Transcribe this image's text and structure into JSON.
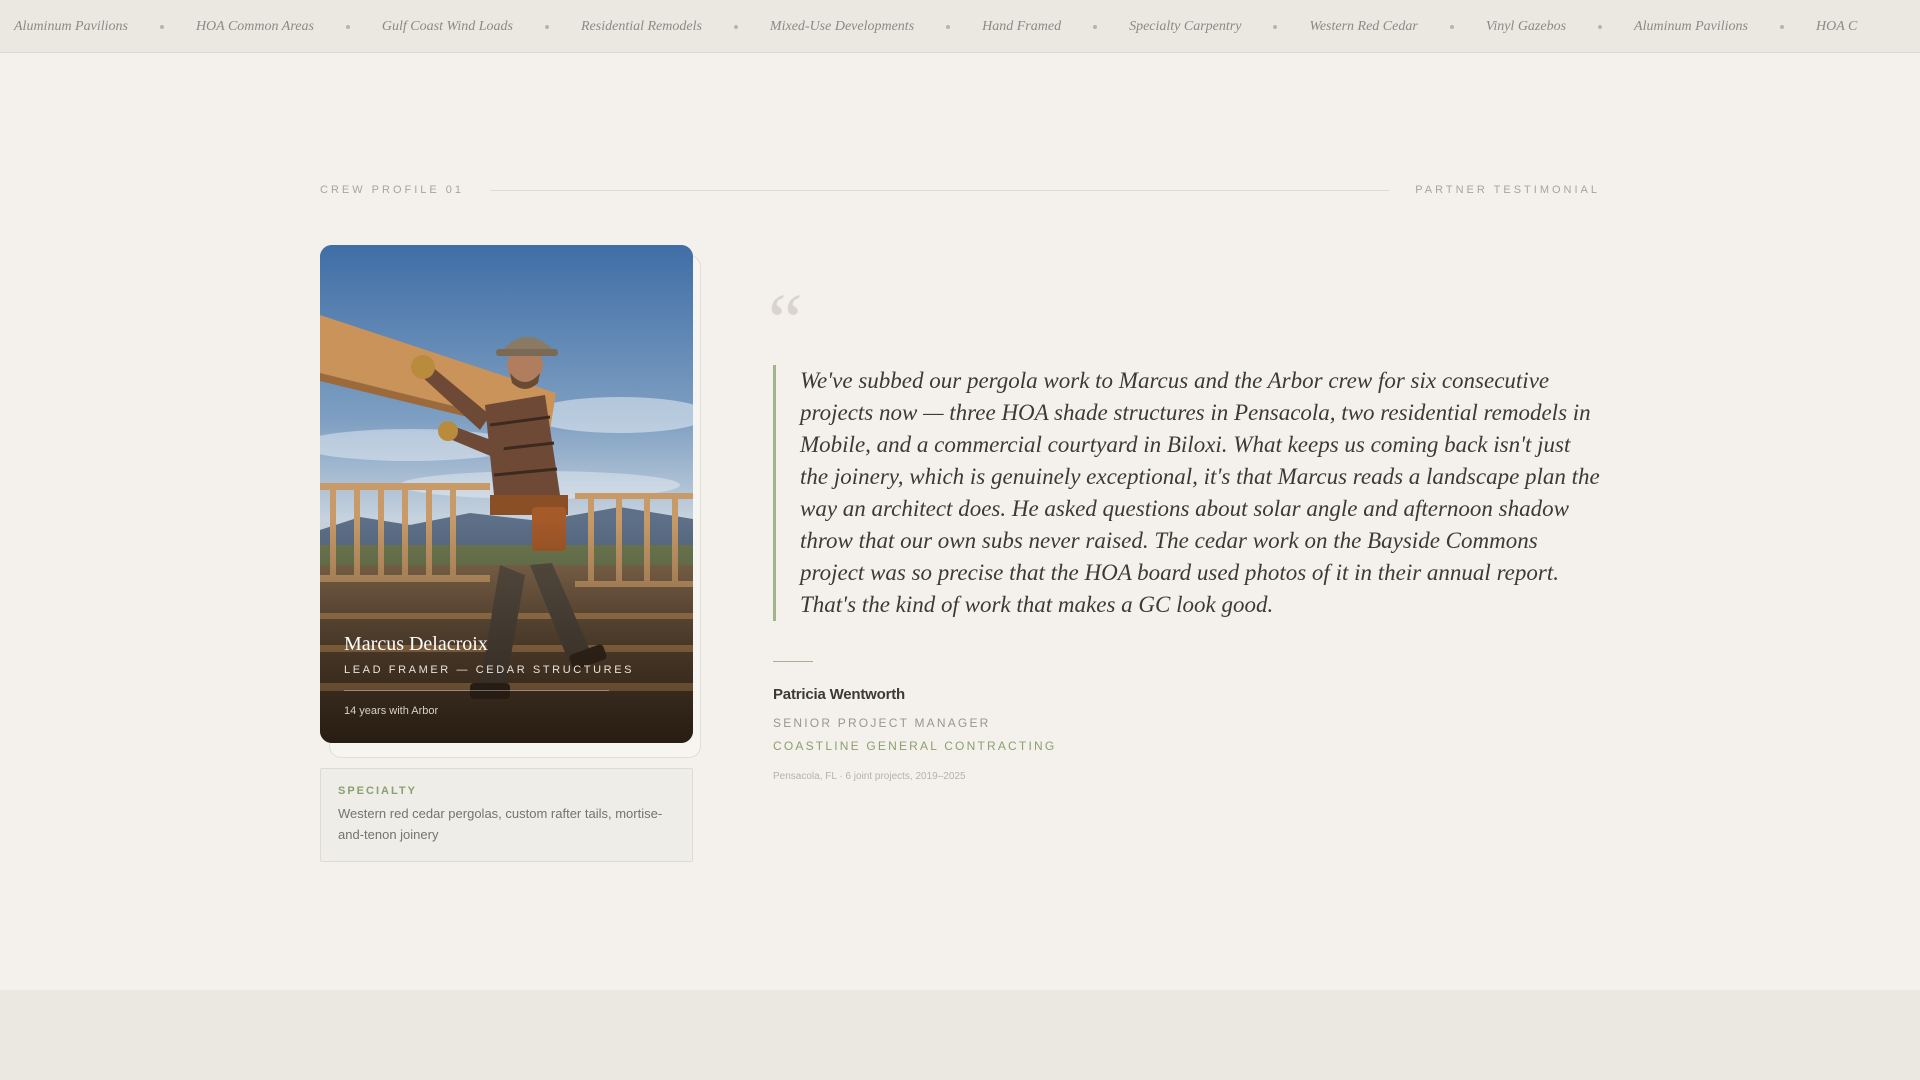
{
  "ticker": {
    "items": [
      "Aluminum Pavilions",
      "HOA Common Areas",
      "Gulf Coast Wind Loads",
      "Residential Remodels",
      "Mixed-Use Developments",
      "Hand Framed",
      "Specialty Carpentry",
      "Western Red Cedar",
      "Vinyl Gazebos",
      "Aluminum Pavilions",
      "HOA C"
    ]
  },
  "section": {
    "left_label": "CREW PROFILE 01",
    "right_label": "PARTNER TESTIMONIAL"
  },
  "profile": {
    "name": "Marcus Delacroix",
    "role": "LEAD FRAMER — CEDAR STRUCTURES",
    "tenure": "14 years with Arbor",
    "photo_icon": "construction-worker-photo"
  },
  "specialty": {
    "label": "SPECIALTY",
    "text": "Western red cedar pergolas, custom rafter tails, mortise-and-tenon joinery"
  },
  "testimonial": {
    "quote_mark": "“",
    "quote": "We've subbed our pergola work to Marcus and the Arbor crew for six consecutive projects now — three HOA shade structures in Pensacola, two residential remodels in Mobile, and a commercial courtyard in Biloxi. What keeps us coming back isn't just the joinery, which is genuinely exceptional, it's that Marcus reads a landscape plan the way an architect does. He asked questions about solar angle and afternoon shadow throw that our own subs never raised. The cedar work on the Bayside Commons project was so precise that the HOA board used photos of it in their annual report. That's the kind of work that makes a GC look good.",
    "author_name": "Patricia Wentworth",
    "author_title": "SENIOR PROJECT MANAGER",
    "author_company": "COASTLINE GENERAL CONTRACTING",
    "meta": "Pensacola, FL · 6 joint projects, 2019–2025"
  },
  "colors": {
    "background": "#f4f1ec",
    "accent_green": "#8ba06e",
    "quote_rule": "#a3b38c",
    "text_dark": "#3b3a37"
  }
}
